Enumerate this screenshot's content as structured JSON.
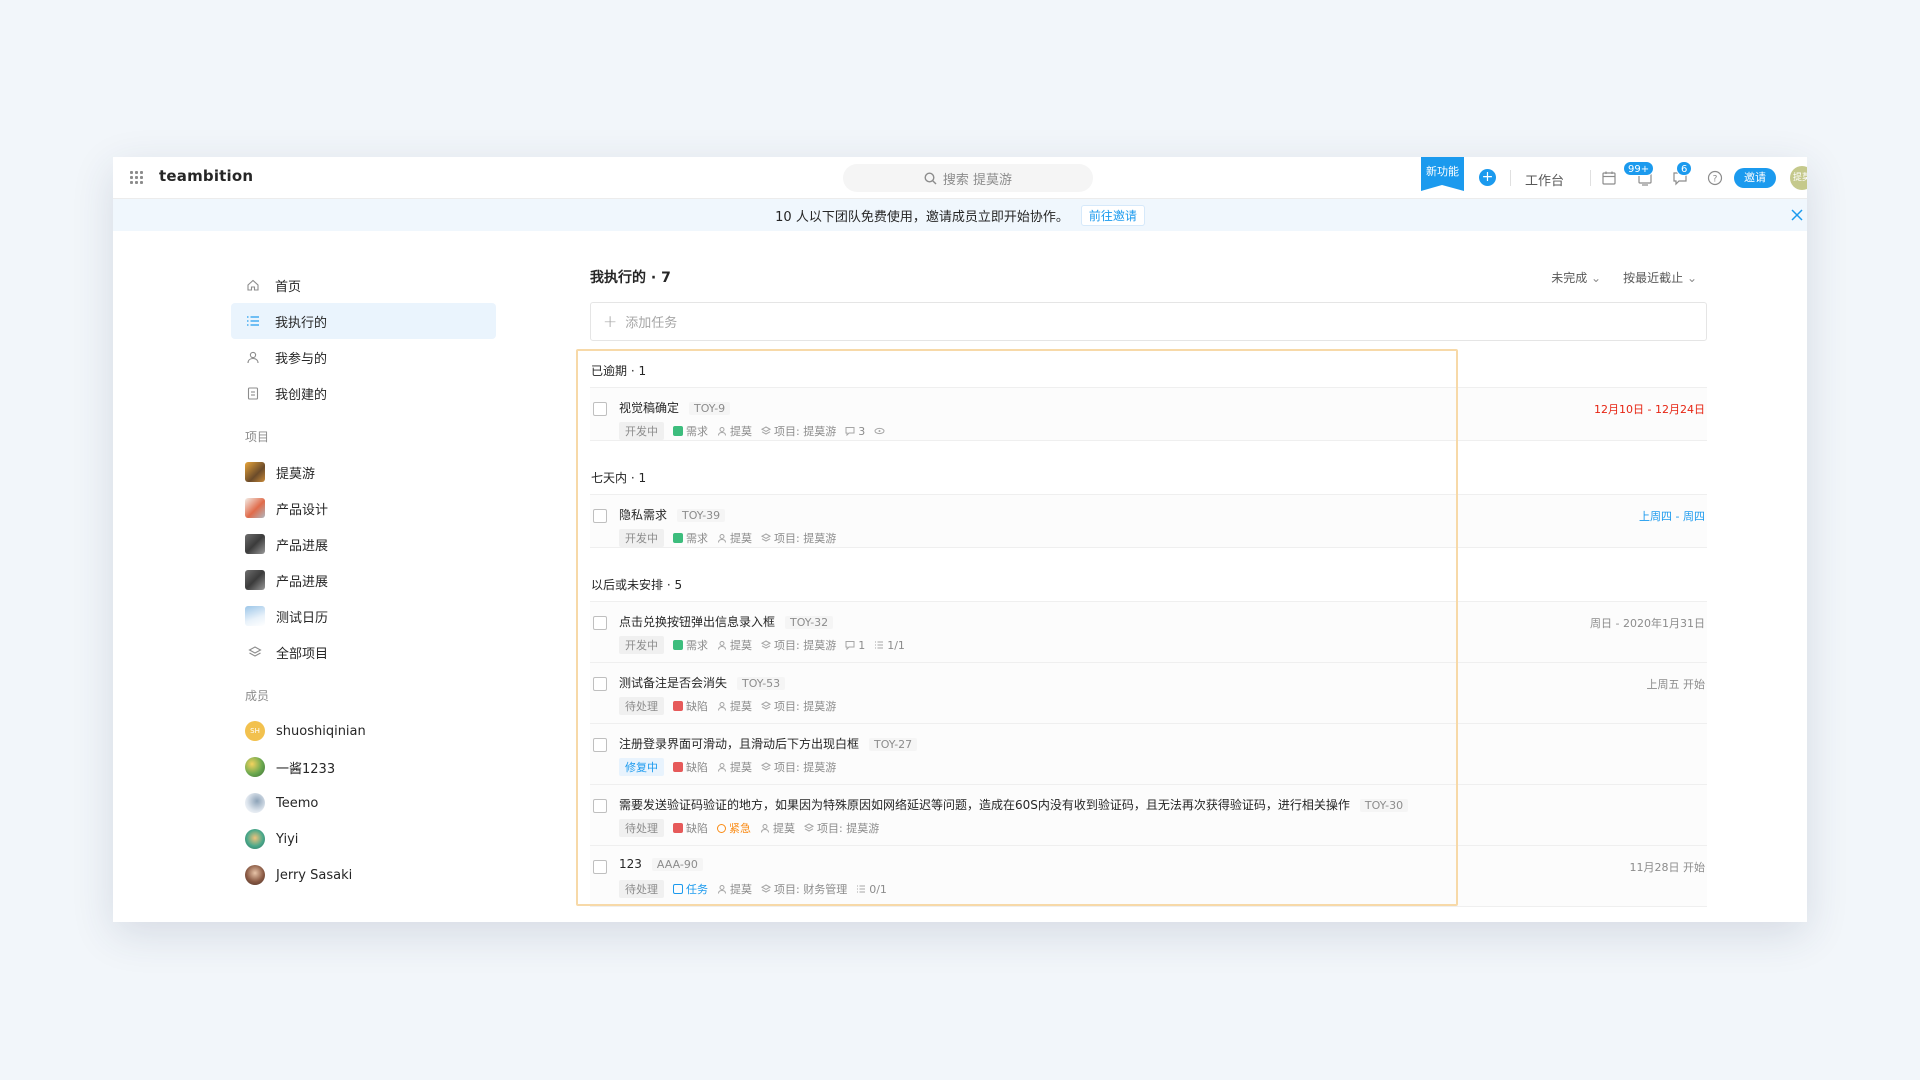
{
  "app": {
    "brand": "teambition"
  },
  "search": {
    "label": "搜索 提莫游"
  },
  "topbar": {
    "new_feature": "新功能",
    "workbench": "工作台",
    "notif_badge": "99+",
    "msg_badge": "6",
    "invite": "邀请",
    "avatar_text": "提莫"
  },
  "notice": {
    "text": "10 人以下团队免费使用，邀请成员立即开始协作。",
    "link": "前往邀请"
  },
  "sidebar": {
    "nav": [
      {
        "label": "首页",
        "icon": "home-icon"
      },
      {
        "label": "我执行的",
        "icon": "list-icon"
      },
      {
        "label": "我参与的",
        "icon": "users-icon"
      },
      {
        "label": "我创建的",
        "icon": "clipboard-icon"
      }
    ],
    "projects_title": "项目",
    "projects": [
      {
        "label": "提莫游"
      },
      {
        "label": "产品设计"
      },
      {
        "label": "产品进展"
      },
      {
        "label": "产品进展"
      },
      {
        "label": "测试日历"
      },
      {
        "label": "全部项目"
      }
    ],
    "members_title": "成员",
    "members": [
      {
        "label": "shuoshiqinian",
        "initials": "SH"
      },
      {
        "label": "一酱1233"
      },
      {
        "label": "Teemo"
      },
      {
        "label": "Yiyi"
      },
      {
        "label": "Jerry Sasaki"
      }
    ]
  },
  "main": {
    "title": "我执行的 · 7",
    "filter_status": "未完成",
    "filter_sort": "按最近截止",
    "add_task_placeholder": "添加任务",
    "groups": [
      {
        "title": "已逾期 · 1",
        "tasks": [
          {
            "title": "视觉稿确定",
            "id": "TOY-9",
            "status": "开发中",
            "type": "需求",
            "assignee": "提莫",
            "project": "项目: 提莫游",
            "comments": "3",
            "date": "12月10日 - 12月24日"
          }
        ]
      },
      {
        "title": "七天内 · 1",
        "tasks": [
          {
            "title": "隐私需求",
            "id": "TOY-39",
            "status": "开发中",
            "type": "需求",
            "assignee": "提莫",
            "project": "项目: 提莫游",
            "date": "上周四 - 周四"
          }
        ]
      },
      {
        "title": "以后或未安排 · 5",
        "tasks": [
          {
            "title": "点击兑换按钮弹出信息录入框",
            "id": "TOY-32",
            "status": "开发中",
            "type": "需求",
            "assignee": "提莫",
            "project": "项目: 提莫游",
            "comments": "1",
            "subtasks": "1/1",
            "date": "周日 - 2020年1月31日"
          },
          {
            "title": "测试备注是否会消失",
            "id": "TOY-53",
            "status": "待处理",
            "type": "缺陷",
            "assignee": "提莫",
            "project": "项目: 提莫游",
            "date": "上周五 开始"
          },
          {
            "title": "注册登录界面可滑动，且滑动后下方出现白框",
            "id": "TOY-27",
            "status": "修复中",
            "type": "缺陷",
            "assignee": "提莫",
            "project": "项目: 提莫游"
          },
          {
            "title": "需要发送验证码验证的地方，如果因为特殊原因如网络延迟等问题，造成在60S内没有收到验证码，且无法再次获得验证码，进行相关操作",
            "id": "TOY-30",
            "status": "待处理",
            "type": "缺陷",
            "priority": "紧急",
            "assignee": "提莫",
            "project": "项目: 提莫游"
          },
          {
            "title": "123",
            "id": "AAA-90",
            "status": "待处理",
            "type": "任务",
            "assignee": "提莫",
            "project": "项目: 财务管理",
            "subtasks": "0/1",
            "date": "11月28日 开始"
          }
        ]
      }
    ]
  },
  "colors": {
    "accent": "#1b9aee",
    "overdue": "#e62412",
    "highlight_border": "#f7d9a8"
  }
}
